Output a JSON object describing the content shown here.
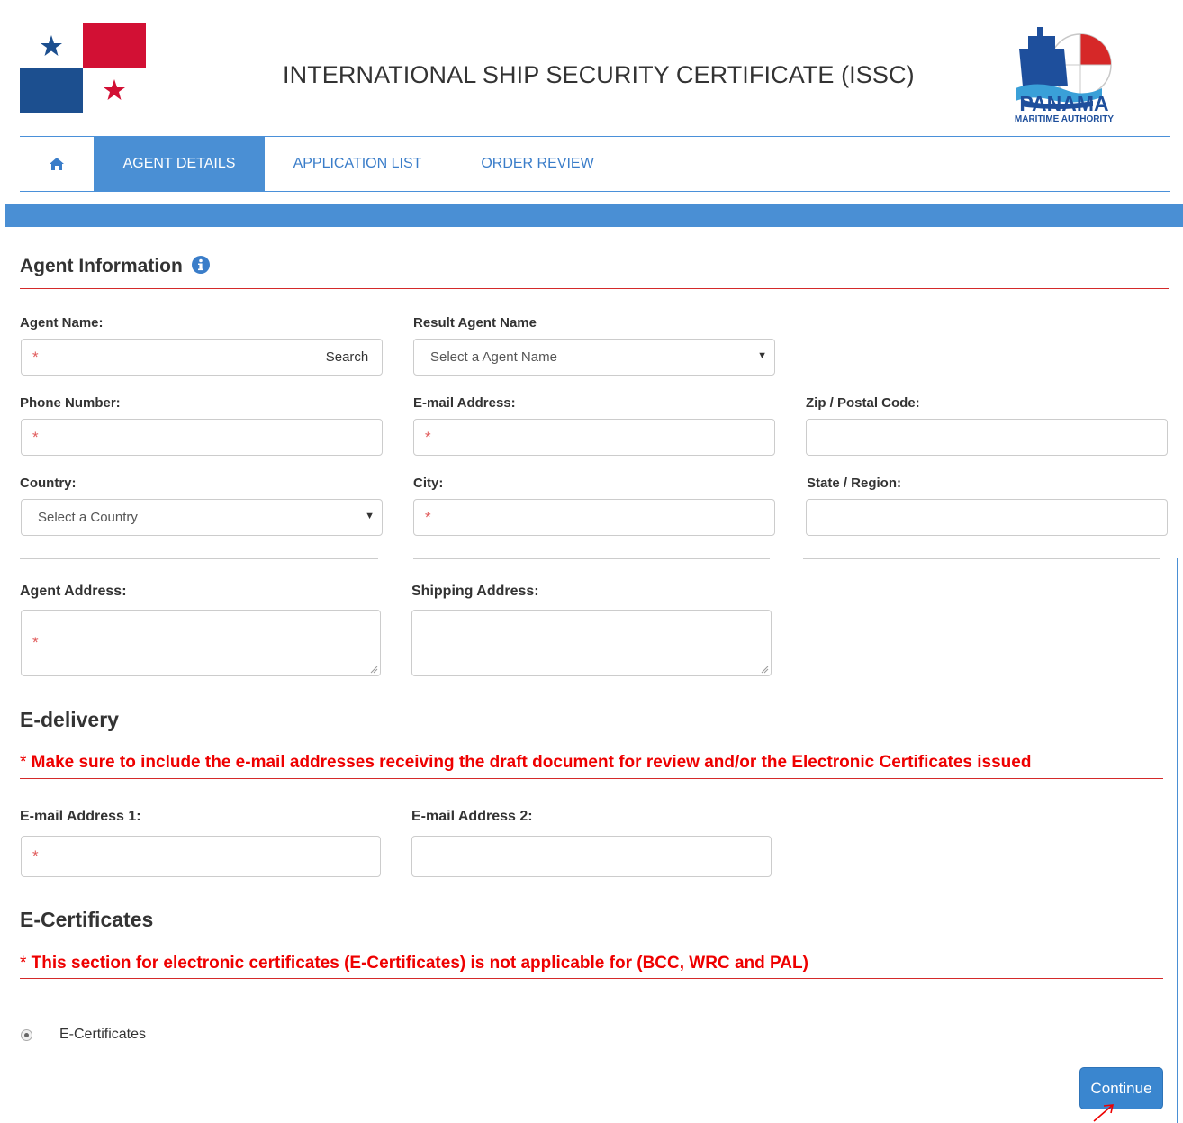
{
  "header": {
    "title": "INTERNATIONAL SHIP SECURITY CERTIFICATE (ISSC)",
    "logo_main": "PANAMA",
    "logo_sub": "MARITIME AUTHORITY"
  },
  "nav": {
    "home_icon": "home-icon",
    "tabs": [
      {
        "label": "AGENT DETAILS",
        "active": true
      },
      {
        "label": "APPLICATION LIST",
        "active": false
      },
      {
        "label": "ORDER REVIEW",
        "active": false
      }
    ]
  },
  "agent_info": {
    "title": "Agent Information",
    "info_icon": "info-circle-icon",
    "fields": {
      "agent_name": {
        "label": "Agent Name:",
        "required": "*",
        "button": "Search"
      },
      "result_agent_name": {
        "label": "Result Agent Name",
        "selected": "Select a Agent Name"
      },
      "phone": {
        "label": "Phone Number:",
        "required": "*"
      },
      "email": {
        "label": "E-mail Address:",
        "required": "*"
      },
      "zip": {
        "label": "Zip / Postal Code:"
      },
      "country": {
        "label": "Country:",
        "selected": "Select a Country"
      },
      "city": {
        "label": "City:",
        "required": "*"
      },
      "state": {
        "label": "State / Region:"
      },
      "agent_address": {
        "label": "Agent Address:",
        "required": "*"
      },
      "shipping_address": {
        "label": "Shipping Address:"
      }
    }
  },
  "edelivery": {
    "title": "E-delivery",
    "notice_star": "*",
    "notice": " Make sure to include the e-mail addresses receiving the draft document for review and/or the Electronic Certificates issued",
    "email1": {
      "label": "E-mail Address 1:",
      "required": "*"
    },
    "email2": {
      "label": "E-mail Address 2:"
    }
  },
  "ecertificates": {
    "title": "E-Certificates",
    "notice_star": "*",
    "notice": " This section for electronic certificates (E-Certificates) is not applicable for (BCC, WRC and PAL)",
    "radio_label": "E-Certificates"
  },
  "actions": {
    "continue": "Continue"
  },
  "colors": {
    "accent": "#4a8fd4",
    "link": "#3a7dc9",
    "warning": "#e00000",
    "flag_red": "#d21034",
    "flag_blue": "#1c4f8f"
  }
}
